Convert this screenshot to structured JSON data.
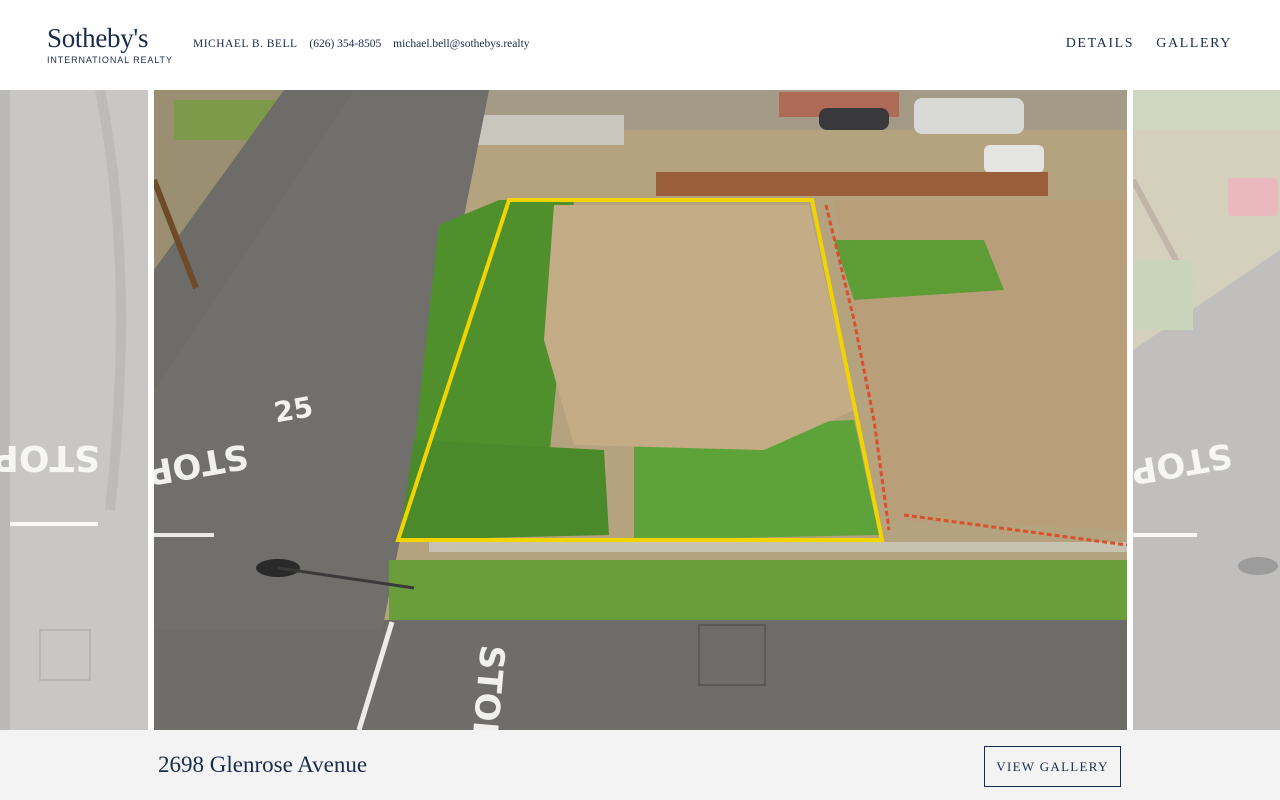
{
  "brand": {
    "name": "Sotheby's",
    "subtitle": "INTERNATIONAL REALTY"
  },
  "agent": {
    "name": "MICHAEL B. BELL",
    "phone": "(626) 354-8505",
    "email": "michael.bell@sothebys.realty"
  },
  "nav": {
    "items": [
      "DETAILS",
      "GALLERY"
    ]
  },
  "gallery": {
    "street_marking_number": "25",
    "stop_text": "STOP",
    "outline_color": "#f2d400"
  },
  "listing": {
    "address": "2698 Glenrose Avenue",
    "view_gallery_label": "VIEW GALLERY"
  },
  "colors": {
    "navy": "#1a2b4c",
    "footer_bg": "#f3f3f3"
  }
}
